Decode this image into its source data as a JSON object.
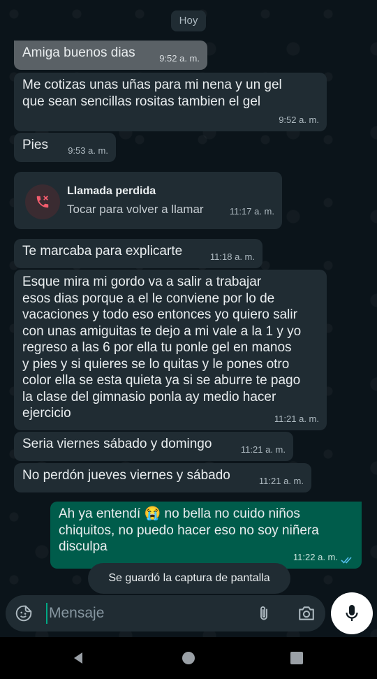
{
  "chat": {
    "day_chip": "Hoy",
    "messages": [
      {
        "text": "Amiga buenos dias",
        "time": "9:52 a. m."
      },
      {
        "text": "Me cotizas unas uñas para mi nena y un gel\nque sean sencillas rositas tambien el gel",
        "time": "9:52 a. m."
      },
      {
        "text": "Pies",
        "time": "9:53 a. m."
      },
      {
        "text": "Te marcaba para explicarte",
        "time": "11:18 a. m."
      },
      {
        "text": "Esque mira mi gordo va a salir a trabajar\nesos dias porque a el le conviene por lo de\nvacaciones y todo eso entonces yo quiero salir\ncon unas amiguitas te dejo a mi vale a la 1 y yo\nregreso a las 6 por ella tu ponle gel en manos\ny pies y si quieres se lo quitas y le pones otro\ncolor ella se esta quieta ya si se aburre te pago\nla clase del gimnasio ponla ay medio hacer\nejercicio",
        "time": "11:21 a. m."
      },
      {
        "text": "Seria viernes sábado y domingo",
        "time": "11:21 a. m."
      },
      {
        "text": "No perdón jueves viernes y sábado",
        "time": "11:21 a. m."
      }
    ],
    "missed_call": {
      "title": "Llamada perdida",
      "subtitle": "Tocar para volver a llamar",
      "time": "11:17 a. m.",
      "icon": "missed-call-icon"
    },
    "outgoing": {
      "text_before_emoji": "Ah ya entendí ",
      "emoji": "😭",
      "text_after_emoji": " no bella no cuido niños\nchiquitos, no puedo hacer eso no soy niñera\ndisculpa",
      "time": "11:22 a. m.",
      "status_icon": "double-check-read-icon"
    }
  },
  "toast": "Se guardó la captura de pantalla",
  "composer": {
    "placeholder": "Mensaje",
    "icons": [
      "sticker-icon",
      "attach-icon",
      "camera-icon",
      "mic-icon"
    ]
  },
  "nav": {
    "icons": [
      "back-icon",
      "home-icon",
      "recents-icon"
    ]
  },
  "colors": {
    "background": "#0b141a",
    "incoming_bubble": "#202c33",
    "outgoing_bubble": "#005c4b",
    "read_ticks": "#53bdeb",
    "missed_call_red": "#f15c6d"
  }
}
